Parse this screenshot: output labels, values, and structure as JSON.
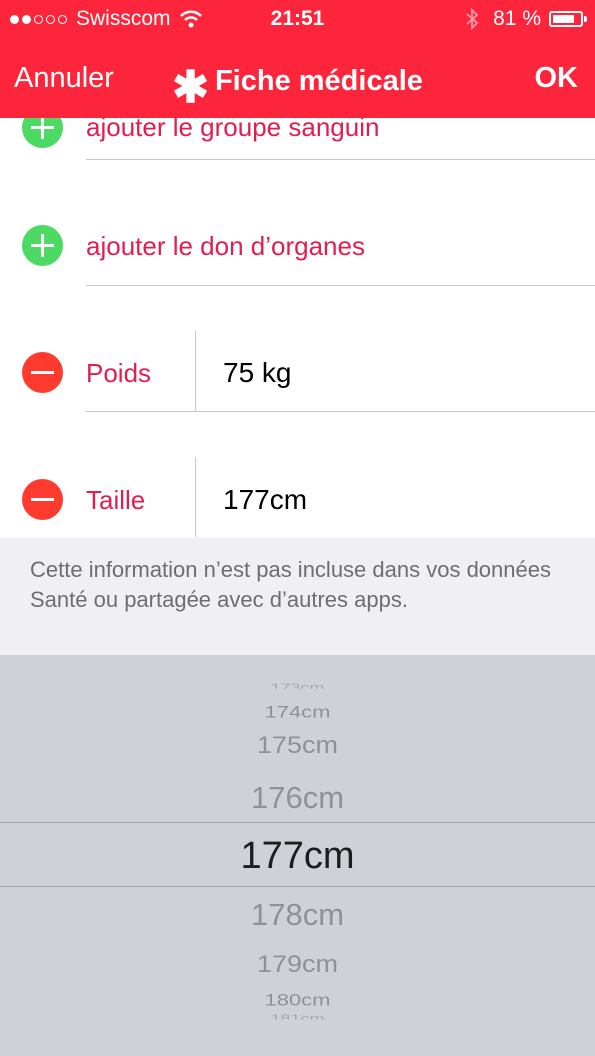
{
  "status_bar": {
    "carrier": "Swisscom",
    "time": "21:51",
    "battery": "81 %",
    "battery_level": 0.81
  },
  "nav": {
    "cancel_label": "Annuler",
    "title_icon": "✱",
    "title": "Fiche médicale",
    "ok_label": "OK"
  },
  "rows": {
    "blood_group": "ajouter le groupe sanguin",
    "organ_donor": "ajouter le don d’organes",
    "weight_label": "Poids",
    "weight_value": "75 kg",
    "height_label": "Taille",
    "height_value": "177cm"
  },
  "info_text": "Cette information n’est pas incluse dans vos données Santé ou partagée avec d’autres apps.",
  "picker": {
    "options": [
      "173cm",
      "174cm",
      "175cm",
      "176cm",
      "177cm",
      "178cm",
      "179cm",
      "180cm",
      "181cm"
    ],
    "selected": "177cm"
  },
  "colors": {
    "accent": "#fc253b",
    "label": "#e21d4f",
    "add": "#4cd964",
    "remove": "#ff3b30"
  }
}
